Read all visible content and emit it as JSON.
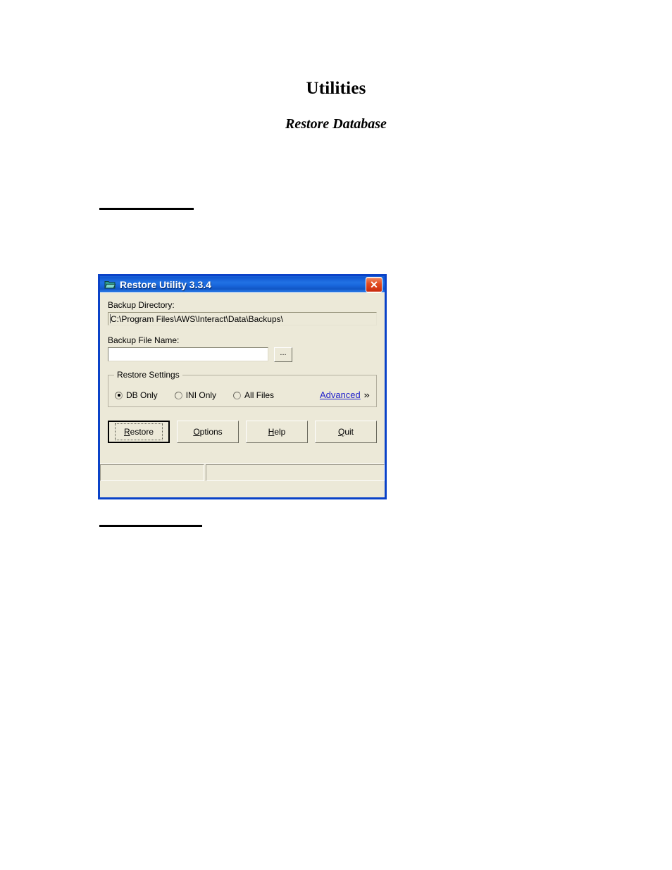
{
  "document": {
    "title": "Utilities",
    "subtitle": "Restore Database"
  },
  "dialog": {
    "title": "Restore Utility 3.3.4",
    "icon": "application-folder-icon",
    "close_label": "✕",
    "backup_directory": {
      "label": "Backup Directory:",
      "value": "C:\\Program Files\\AWS\\Interact\\Data\\Backups\\"
    },
    "backup_file_name": {
      "label": "Backup File Name:",
      "value": "",
      "placeholder": "",
      "browse_label": "..."
    },
    "restore_settings": {
      "legend": "Restore Settings",
      "options": [
        {
          "label": "DB Only",
          "selected": true
        },
        {
          "label": "INI Only",
          "selected": false
        },
        {
          "label": "All Files",
          "selected": false
        }
      ],
      "advanced_label": "Advanced",
      "advanced_chevron": "»"
    },
    "buttons": [
      {
        "accel": "R",
        "rest": "estore",
        "default": true
      },
      {
        "accel": "O",
        "rest": "ptions",
        "default": false
      },
      {
        "accel": "H",
        "rest": "elp",
        "default": false
      },
      {
        "accel": "Q",
        "rest": "uit",
        "default": false
      }
    ],
    "statusbar": {
      "panel_1": "",
      "panel_2": ""
    }
  },
  "colors": {
    "titlebar_blue": "#1a62d6",
    "dialog_face": "#ece9d8",
    "close_red": "#e24b20",
    "link_blue": "#2222cc",
    "window_border": "#0a42c8"
  }
}
